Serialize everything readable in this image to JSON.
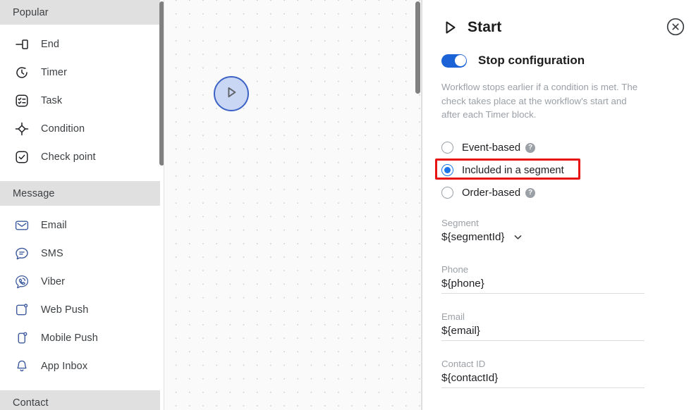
{
  "sidebar": {
    "sections": [
      {
        "title": "Popular",
        "items": [
          {
            "label": "End",
            "icon": "end-icon"
          },
          {
            "label": "Timer",
            "icon": "timer-icon"
          },
          {
            "label": "Task",
            "icon": "task-icon"
          },
          {
            "label": "Condition",
            "icon": "condition-icon"
          },
          {
            "label": "Check point",
            "icon": "check-point-icon"
          }
        ]
      },
      {
        "title": "Message",
        "items": [
          {
            "label": "Email",
            "icon": "email-icon"
          },
          {
            "label": "SMS",
            "icon": "sms-icon"
          },
          {
            "label": "Viber",
            "icon": "viber-icon"
          },
          {
            "label": "Web Push",
            "icon": "web-push-icon"
          },
          {
            "label": "Mobile Push",
            "icon": "mobile-push-icon"
          },
          {
            "label": "App Inbox",
            "icon": "app-inbox-icon"
          }
        ]
      },
      {
        "title": "Contact",
        "items": []
      }
    ]
  },
  "canvas": {
    "node_label": "Start",
    "node_icon": "play-icon"
  },
  "panel": {
    "title": "Start",
    "title_icon": "play-icon",
    "close_icon": "close-icon",
    "toggle": {
      "label": "Stop configuration",
      "state": "on",
      "accent": "#1a62d6"
    },
    "help_text": "Workflow stops earlier if a condition is met. The check takes place at the workflow's start and after each Timer block.",
    "radio_group": {
      "selected": "Included in a segment",
      "options": [
        {
          "label": "Event-based",
          "has_help": true,
          "selected": false,
          "highlighted": false
        },
        {
          "label": "Included in a segment",
          "has_help": false,
          "selected": true,
          "highlighted": true
        },
        {
          "label": "Order-based",
          "has_help": true,
          "selected": false,
          "highlighted": false
        }
      ],
      "highlight_color": "#e81313"
    },
    "fields": [
      {
        "label": "Segment",
        "value": "${segmentId}",
        "type": "dropdown",
        "underline": false
      },
      {
        "label": "Phone",
        "value": "${phone}",
        "type": "text",
        "underline": true
      },
      {
        "label": "Email",
        "value": "${email}",
        "type": "text",
        "underline": true
      },
      {
        "label": "Contact ID",
        "value": "${contactId}",
        "type": "text",
        "underline": true
      }
    ]
  }
}
